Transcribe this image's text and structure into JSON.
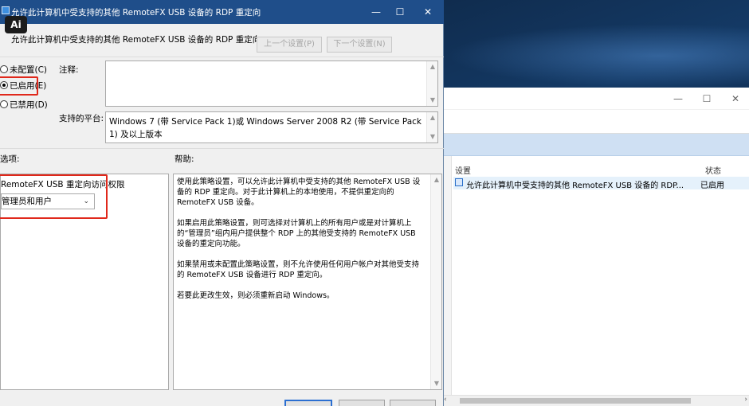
{
  "dialog": {
    "title": "允许此计算机中受支持的其他 RemoteFX USB 设备的 RDP 重定向",
    "policy_name": "允许此计算机中受支持的其他 RemoteFX USB 设备的 RDP 重定向",
    "prev_setting": "上一个设置(P)",
    "next_setting": "下一个设置(N)",
    "radio_not_configured": "未配置(C)",
    "radio_enabled": "已启用(E)",
    "radio_disabled": "已禁用(D)",
    "selected_state": "enabled",
    "comment_label": "注释:",
    "platform_label": "支持的平台:",
    "platform_text": "Windows 7 (带 Service Pack 1)或 Windows Server 2008 R2 (带 Service Pack 1) 及以上版本",
    "options_label": "选项:",
    "help_label": "帮助:",
    "option_name": "RemoteFX USB 重定向访问权限",
    "option_value": "管理员和用户",
    "help_paragraphs": [
      "使用此策略设置，可以允许此计算机中受支持的其他 RemoteFX USB 设备的 RDP 重定向。对于此计算机上的本地使用，不提供重定向的 RemoteFX USB 设备。",
      "如果启用此策略设置，则可选择对计算机上的所有用户或是对计算机上的“管理员”组内用户提供整个 RDP 上的其他受支持的 RemoteFX USB 设备的重定向功能。",
      "如果禁用或未配置此策略设置，则不允许使用任何用户帐户对其他受支持的 RemoteFX USB 设备进行 RDP 重定向。",
      "若要此更改生效，则必须重新启动 Windows。"
    ]
  },
  "badge": {
    "text": "Ai"
  },
  "background_window": {
    "col_setting": "设置",
    "col_state": "状态",
    "row_setting": "允许此计算机中受支持的其他 RemoteFX USB 设备的 RDP...",
    "row_state": "已启用"
  },
  "icons": {
    "minimize": "minimize-icon",
    "maximize": "maximize-icon",
    "close": "close-icon",
    "dropdown": "chevron-down-icon"
  },
  "colors": {
    "titlebar": "#1f4e8a",
    "highlight_box": "#e0281b",
    "selected_row": "#e5f1fb"
  }
}
